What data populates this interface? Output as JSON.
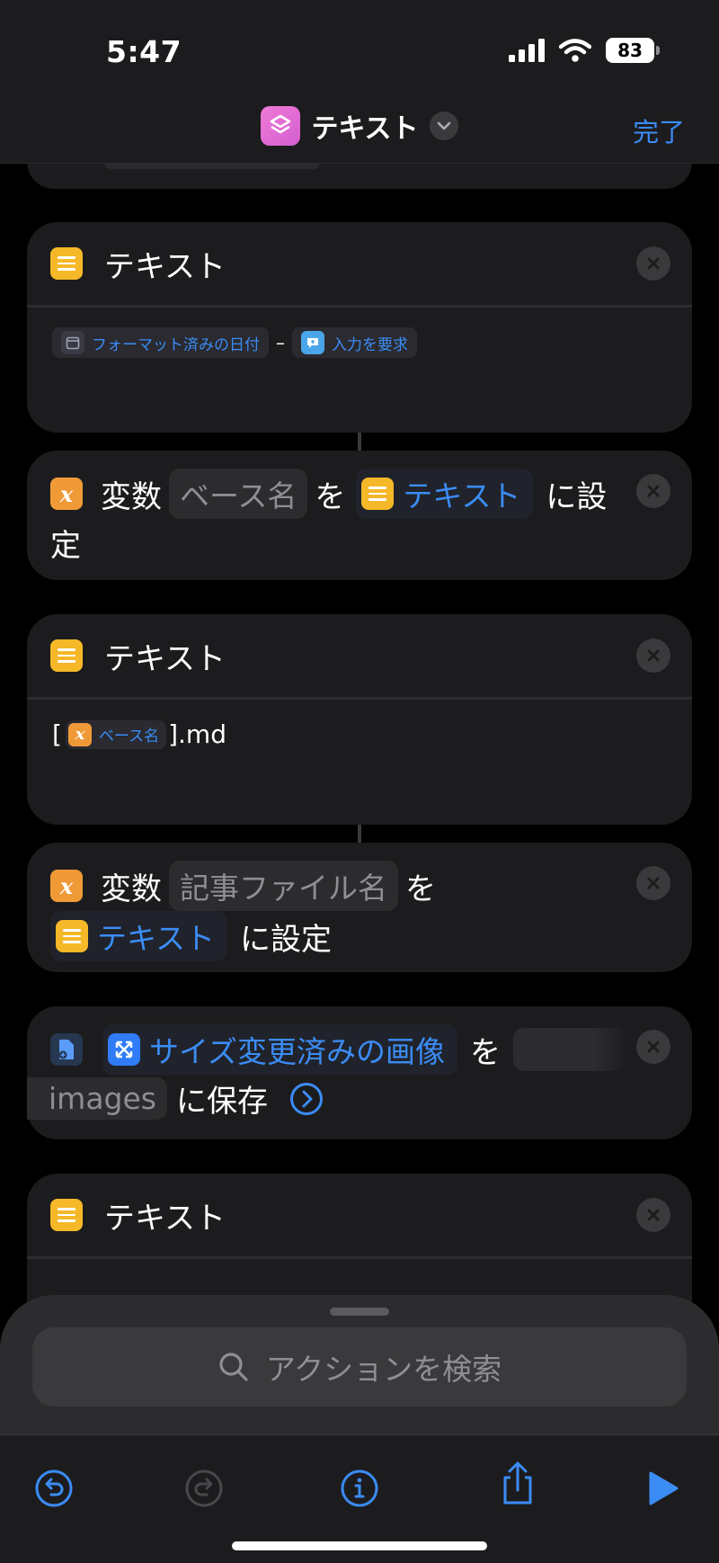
{
  "status": {
    "time": "5:47",
    "battery": "83"
  },
  "header": {
    "title": "テキスト",
    "done_label": "完了"
  },
  "card1": {
    "title": "テキスト",
    "token_date": "フォーマット済みの日付",
    "separator": "–",
    "token_input": "入力を要求"
  },
  "var1": {
    "prefix": "変数",
    "name": "ベース名",
    "particle": "を",
    "value": "テキスト",
    "suffix_a": "に設",
    "suffix_b": "定"
  },
  "card2": {
    "title": "テキスト",
    "bracket_open": "[",
    "token": "ベース名",
    "text_after": "].md"
  },
  "var2": {
    "prefix": "変数",
    "name": "記事ファイル名",
    "particle": "を",
    "value": "テキスト",
    "suffix": "に設定"
  },
  "save": {
    "value": "サイズ変更済みの画像",
    "particle": "を",
    "folder": "images",
    "suffix": "に保存"
  },
  "card3": {
    "title": "テキスト"
  },
  "search": {
    "placeholder": "アクションを検索"
  }
}
